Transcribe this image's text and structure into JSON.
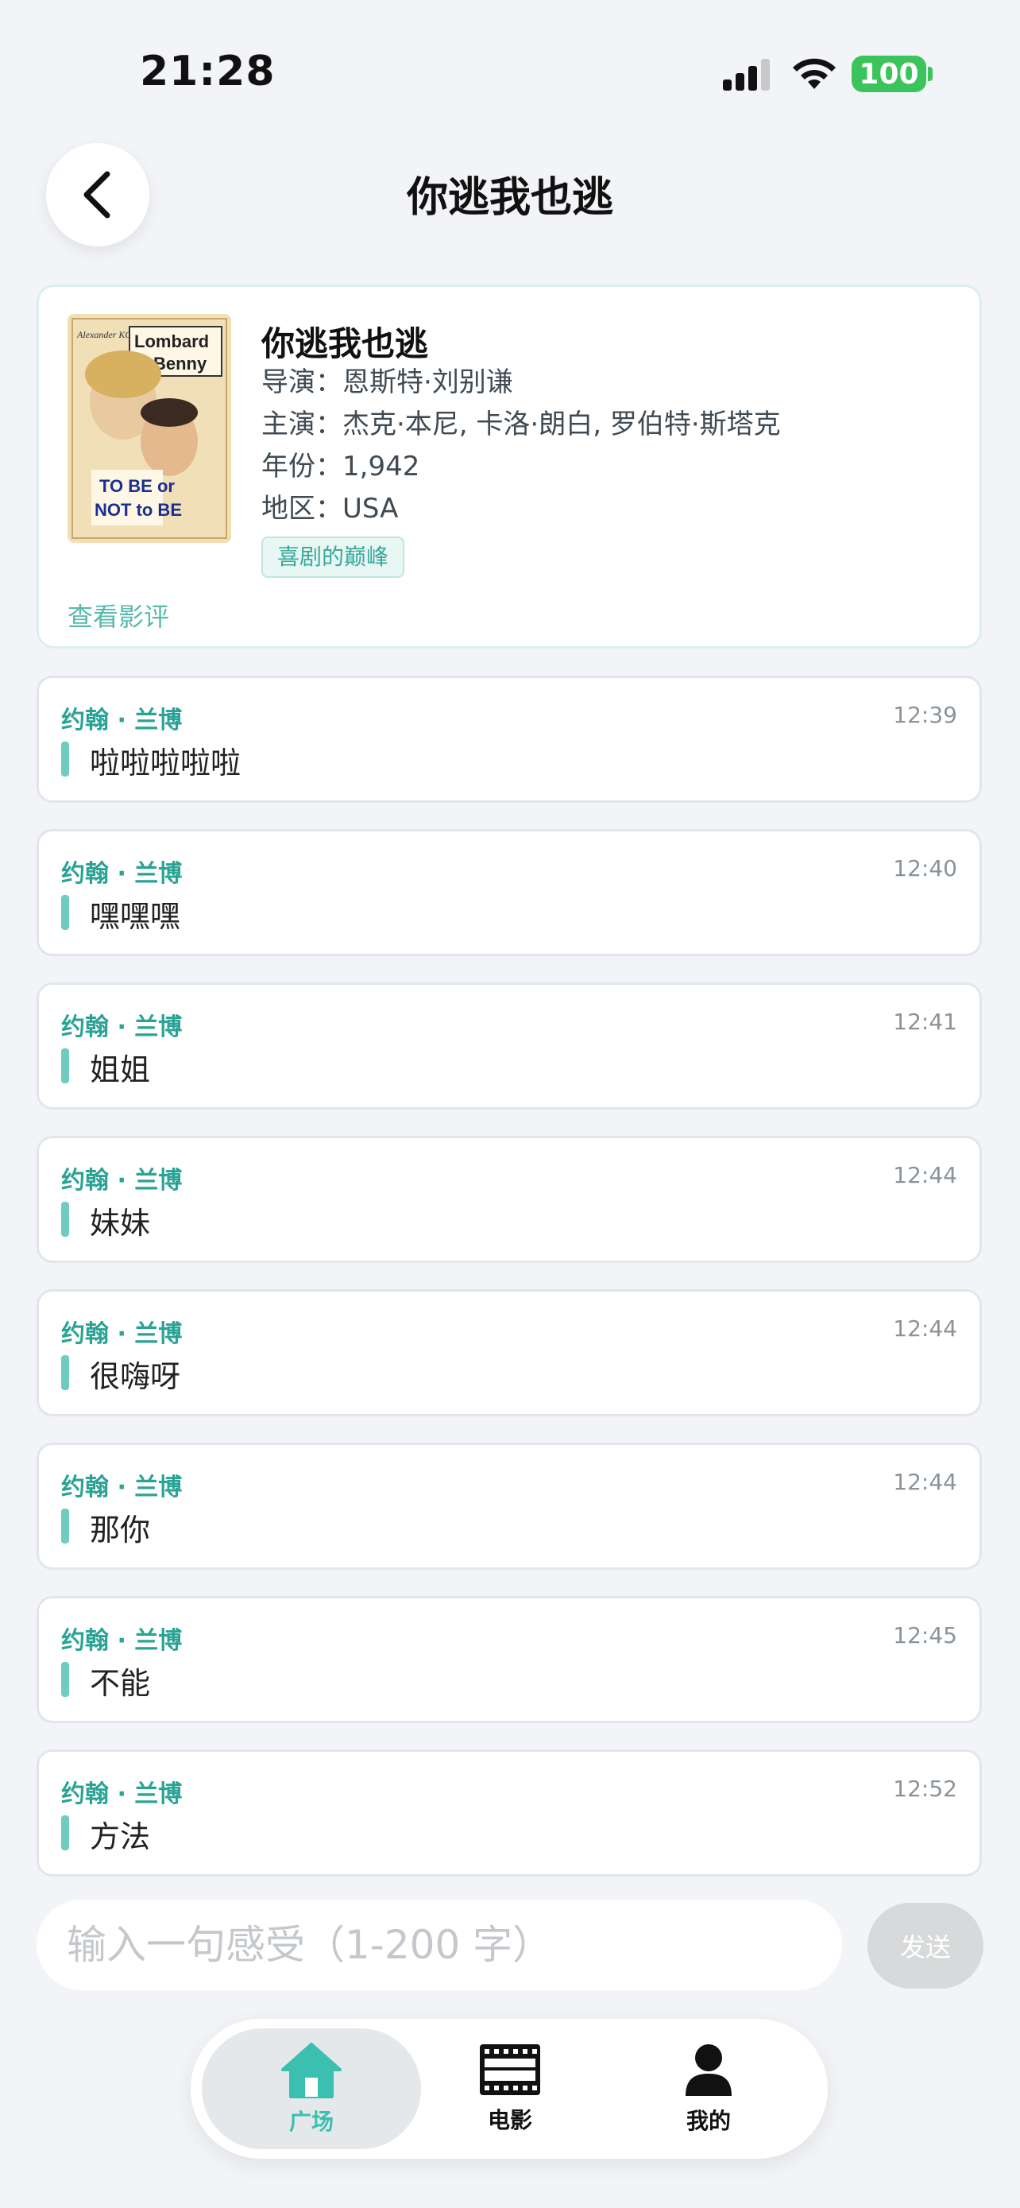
{
  "status_bar": {
    "time": "21:28",
    "battery": "100",
    "icons": [
      "signal-icon",
      "wifi-icon",
      "battery-icon"
    ]
  },
  "header": {
    "title": "你逃我也逃",
    "back_icon": "chevron-left-icon"
  },
  "movie": {
    "title": "你逃我也逃",
    "director_label": "导演：",
    "director": "恩斯特·刘别谦",
    "cast_label": "主演：",
    "cast": "杰克·本尼, 卡洛·朗白, 罗伯特·斯塔克",
    "year_label": "年份：",
    "year": "1,942",
    "region_label": "地区：",
    "region": "USA",
    "tag": "喜剧的巅峰",
    "view_review": "查看影评",
    "poster": {
      "top_left": "Alexander KORDA",
      "name1": "Lombard",
      "name2": "Benny",
      "line1": "TO BE or",
      "line2": "NOT to BE"
    }
  },
  "comments": [
    {
      "author": "约翰 · 兰博",
      "time": "12:39",
      "text": "啦啦啦啦啦"
    },
    {
      "author": "约翰 · 兰博",
      "time": "12:40",
      "text": "嘿嘿嘿"
    },
    {
      "author": "约翰 · 兰博",
      "time": "12:41",
      "text": "姐姐"
    },
    {
      "author": "约翰 · 兰博",
      "time": "12:44",
      "text": "妹妹"
    },
    {
      "author": "约翰 · 兰博",
      "time": "12:44",
      "text": "很嗨呀"
    },
    {
      "author": "约翰 · 兰博",
      "time": "12:44",
      "text": "那你"
    },
    {
      "author": "约翰 · 兰博",
      "time": "12:45",
      "text": "不能"
    },
    {
      "author": "约翰 · 兰博",
      "time": "12:52",
      "text": "方法"
    }
  ],
  "input": {
    "value": "",
    "placeholder": "输入一句感受（1-200 字）",
    "send_label": "发送"
  },
  "tabs": [
    {
      "label": "广场",
      "icon": "home-icon",
      "active": true
    },
    {
      "label": "电影",
      "icon": "film-icon",
      "active": false
    },
    {
      "label": "我的",
      "icon": "user-icon",
      "active": false
    }
  ],
  "colors": {
    "accent": "#3bbfb0",
    "author": "#2aa395",
    "background": "#f2f4f8",
    "battery": "#3cc45c"
  }
}
